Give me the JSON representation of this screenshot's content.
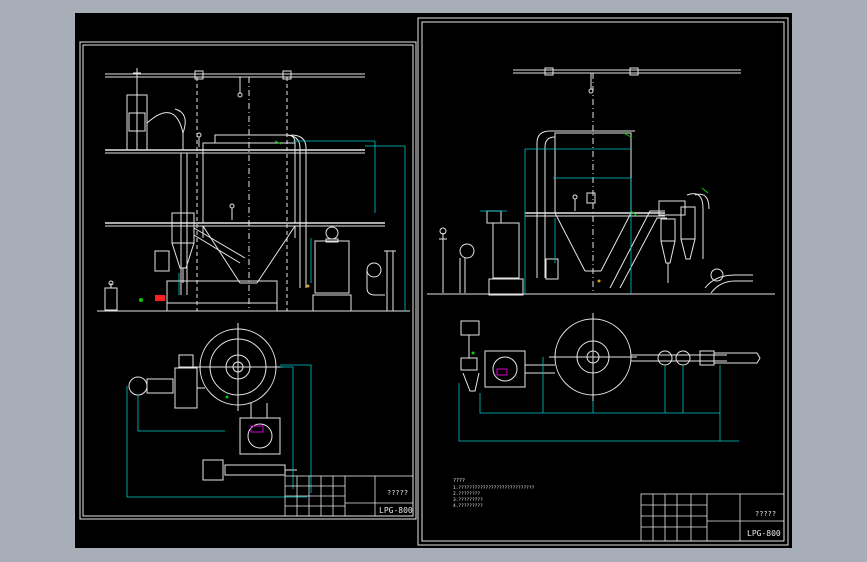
{
  "colors": {
    "background": "#a8aeb8",
    "canvas": "#000000",
    "line": "#e6e6e6",
    "dimension": "#00c8c8",
    "accent_green": "#00d000",
    "accent_red": "#ff2020",
    "accent_magenta": "#d000d0",
    "accent_orange": "#e0a000"
  },
  "left_sheet": {
    "title_block": {
      "drawing_name": "?????",
      "drawing_number": "LPG-800"
    }
  },
  "right_sheet": {
    "title_block": {
      "drawing_name": "?????",
      "drawing_number": "LPG-800"
    },
    "notes": {
      "heading": "????",
      "lines": [
        "1.????????????????????????????",
        "2.????????",
        "3.?????????",
        "4.?????????"
      ]
    }
  }
}
